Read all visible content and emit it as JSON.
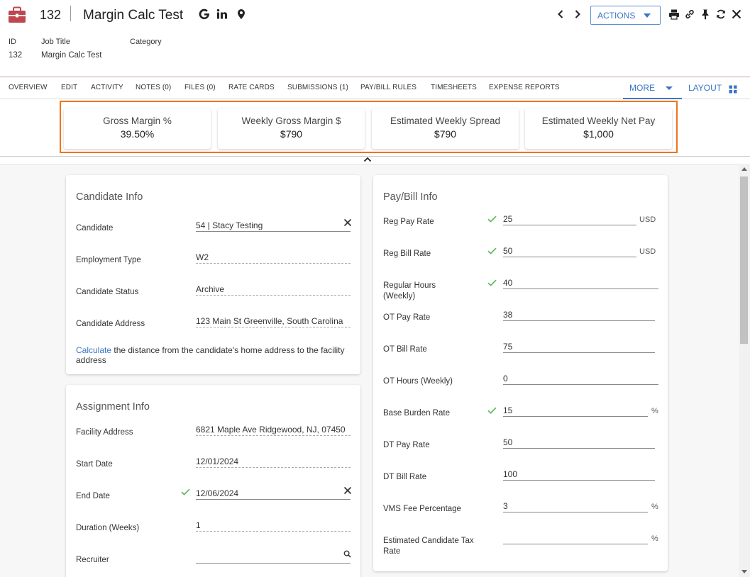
{
  "header": {
    "record_id": "132",
    "record_title": "Margin Calc Test",
    "actions_label": "ACTIONS",
    "meta": [
      {
        "label": "ID",
        "value": "132"
      },
      {
        "label": "Job Title",
        "value": "Margin Calc Test"
      },
      {
        "label": "Category",
        "value": ""
      }
    ]
  },
  "icons": {
    "header": [
      "briefcase-icon",
      "google-icon",
      "linkedin-icon",
      "map-pin-icon"
    ],
    "toolbar": [
      "chevron-left-icon",
      "chevron-right-icon",
      "print-icon",
      "link-icon",
      "pin-icon",
      "refresh-icon",
      "close-icon"
    ],
    "layout": "grid-icon",
    "collapse": "chevron-up-icon",
    "validation": "check-icon",
    "clear": "clear-icon",
    "lookup": "search-icon"
  },
  "tabs": [
    "OVERVIEW",
    "EDIT",
    "ACTIVITY",
    "NOTES (0)",
    "FILES (0)",
    "RATE CARDS",
    "SUBMISSIONS (1)",
    "PAY/BILL RULES",
    "TIMESHEETS",
    "EXPENSE REPORTS"
  ],
  "tab_more": "MORE",
  "tab_layout": "LAYOUT",
  "summary": [
    {
      "label": "Gross Margin %",
      "value": "39.50%"
    },
    {
      "label": "Weekly Gross Margin $",
      "value": "$790"
    },
    {
      "label": "Estimated Weekly Spread",
      "value": "$790"
    },
    {
      "label": "Estimated Weekly Net Pay",
      "value": "$1,000"
    }
  ],
  "candidate_info": {
    "title": "Candidate Info",
    "fields": [
      {
        "label": "Candidate",
        "value": "54 | Stacy  Testing"
      },
      {
        "label": "Employment Type",
        "value": "W2"
      },
      {
        "label": "Candidate Status",
        "value": "Archive"
      },
      {
        "label": "Candidate Address",
        "value": "123 Main St  Greenville, South Carolina"
      }
    ],
    "calc_link": "Calculate",
    "calc_text": " the distance from the candidate's home address to the facility address"
  },
  "assignment_info": {
    "title": "Assignment Info",
    "fields": [
      {
        "label": "Facility Address",
        "value": "6821 Maple Ave  Ridgewood, NJ, 07450"
      },
      {
        "label": "Start Date",
        "value": "12/01/2024"
      },
      {
        "label": "End Date",
        "value": "12/06/2024"
      },
      {
        "label": "Duration (Weeks)",
        "value": "1"
      },
      {
        "label": "Recruiter",
        "value": ""
      }
    ]
  },
  "paybill_info": {
    "title": "Pay/Bill Info",
    "fields": [
      {
        "label": "Reg Pay Rate",
        "value": "25",
        "unit": "USD"
      },
      {
        "label": "Reg Bill Rate",
        "value": "50",
        "unit": "USD"
      },
      {
        "label": "Regular Hours (Weekly)",
        "value": "40",
        "unit": ""
      },
      {
        "label": "OT Pay Rate",
        "value": "38",
        "unit": ""
      },
      {
        "label": "OT Bill Rate",
        "value": "75",
        "unit": ""
      },
      {
        "label": "OT Hours (Weekly)",
        "value": "0",
        "unit": ""
      },
      {
        "label": "Base Burden Rate",
        "value": "15",
        "unit": "%"
      },
      {
        "label": "DT Pay Rate",
        "value": "50",
        "unit": ""
      },
      {
        "label": "DT Bill Rate",
        "value": "100",
        "unit": ""
      },
      {
        "label": "VMS Fee Percentage",
        "value": "3",
        "unit": "%"
      },
      {
        "label": "Estimated Candidate Tax Rate",
        "value": "",
        "unit": "%"
      }
    ]
  },
  "colors": {
    "accent": "#3a76c4",
    "brand_icon": "#c0464f",
    "highlight_border": "#f07318",
    "valid_check": "#5cb85c"
  }
}
